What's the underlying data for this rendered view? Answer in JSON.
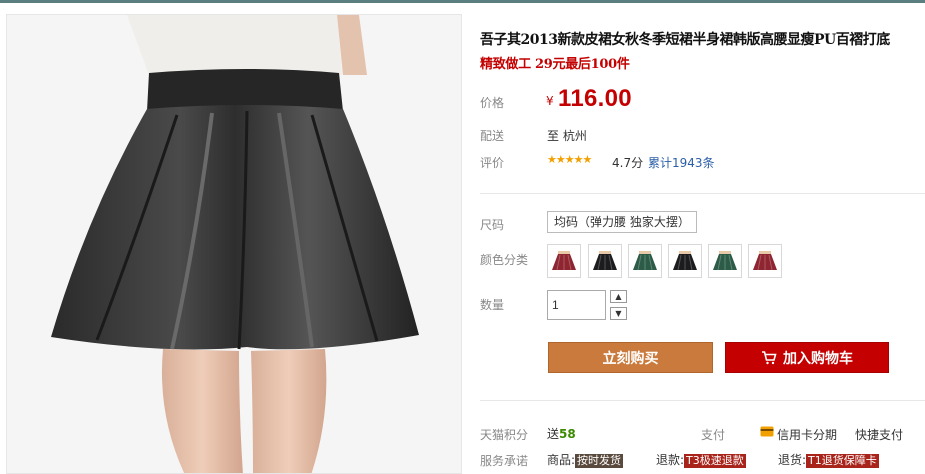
{
  "product": {
    "title": "吾子其2013新款皮裙女秋冬季短裙半身裙韩版高腰显瘦PU百褶打底",
    "subtitle": "精致做工 29元最后100件"
  },
  "price": {
    "label": "价格",
    "currency": "¥",
    "value": "116.00"
  },
  "shipping": {
    "label": "配送",
    "value": "至 杭州"
  },
  "rating": {
    "label": "评价",
    "stars": "★★★★★",
    "score": "4.7分",
    "reviews": "累计1943条",
    "stars_value": 4.7
  },
  "options": {
    "size_label": "尺码",
    "size_value": "均码（弹力腰 独家大摆）",
    "color_label": "颜色分类",
    "colors": [
      "#8e2530",
      "#1c1c1e",
      "#2c5c48",
      "#1c1c1e",
      "#2c5c48",
      "#8e2530"
    ]
  },
  "quantity": {
    "label": "数量",
    "value": "1",
    "up": "▲",
    "down": "▼"
  },
  "actions": {
    "buy_now": "立刻购买",
    "add_to_cart": "加入购物车"
  },
  "points": {
    "label": "天猫积分",
    "prefix": "送",
    "amount": "58"
  },
  "payment": {
    "label": "支付",
    "credit": "信用卡分期",
    "quick": "快捷支付"
  },
  "service": {
    "label": "服务承诺",
    "items": [
      {
        "prefix": "商品:",
        "tag": "按时发货"
      },
      {
        "prefix": "退款:",
        "tag": "T3极速退款"
      },
      {
        "prefix": "退货:",
        "tag": "T1退货保障卡"
      }
    ]
  },
  "colors": {
    "accent_red": "#c40000",
    "buy_button": "#c97a3c",
    "star": "#f2a000",
    "link": "#2b5ea8",
    "points_green": "#3b8a00",
    "top_bar": "#5b7f80"
  }
}
